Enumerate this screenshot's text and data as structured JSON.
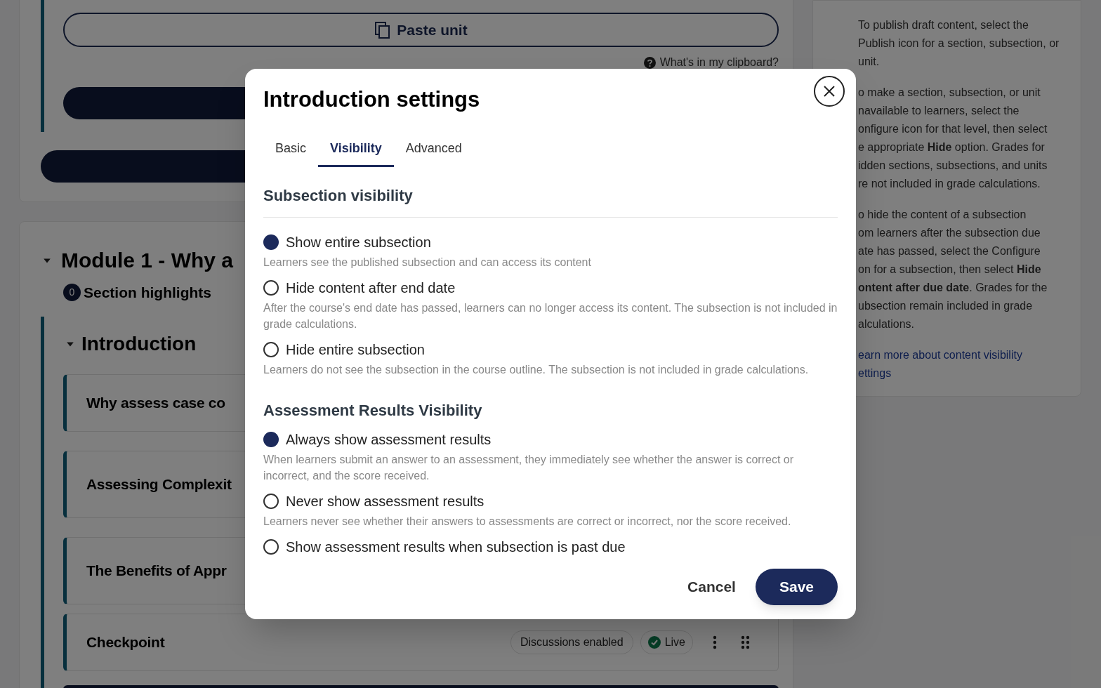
{
  "background": {
    "paste_button": "Paste unit",
    "clipboard_link": "What's in my clipboard?",
    "section": {
      "title": "Module 1 - Why a",
      "expanded": true,
      "highlights_count": "0",
      "highlights_label": "Section highlights"
    },
    "subsection": {
      "title": "Introduction",
      "expanded": true
    },
    "units": [
      {
        "title": "Why assess case co"
      },
      {
        "title": "Assessing Complexit"
      },
      {
        "title": "The Benefits of Appr"
      },
      {
        "title": "Checkpoint",
        "badges": [
          "Discussions enabled"
        ],
        "status": "Live"
      }
    ]
  },
  "help": {
    "paragraphs": [
      {
        "kind": "text",
        "lines": [
          "To publish draft content, select the",
          "Publish icon for a section, subsection, or",
          "unit."
        ]
      },
      {
        "kind": "text",
        "lines": [
          "o make a section, subsection, or unit",
          "navailable to learners, select the",
          "onfigure icon for that level, then select",
          "e appropriate **Hide** option. Grades for",
          "idden sections, subsections, and units",
          "re not included in grade calculations."
        ]
      },
      {
        "kind": "text",
        "lines": [
          "o hide the content of a subsection",
          "om learners after the subsection due",
          "ate has passed, select the Configure",
          "on for a subsection, then select **Hide**",
          "**ontent after due date**. Grades for the",
          "ubsection remain included in grade",
          "alculations."
        ]
      },
      {
        "kind": "link",
        "lines": [
          "earn more about content visibility",
          "ettings"
        ]
      }
    ]
  },
  "dialog": {
    "title": "Introduction settings",
    "tabs": [
      {
        "label": "Basic",
        "selected": false
      },
      {
        "label": "Visibility",
        "selected": true
      },
      {
        "label": "Advanced",
        "selected": false
      }
    ],
    "groups": [
      {
        "heading": "Subsection visibility",
        "divider": true,
        "options": [
          {
            "label": "Show entire subsection",
            "selected": true,
            "description": "Learners see the published subsection and can access its content"
          },
          {
            "label": "Hide content after end date",
            "selected": false,
            "description": "After the course's end date has passed, learners can no longer access its content. The subsection is not included in grade calculations."
          },
          {
            "label": "Hide entire subsection",
            "selected": false,
            "description": "Learners do not see the subsection in the course outline. The subsection is not included in grade calculations."
          }
        ]
      },
      {
        "heading": "Assessment Results Visibility",
        "divider": false,
        "options": [
          {
            "label": "Always show assessment results",
            "selected": true,
            "description": "When learners submit an answer to an assessment, they immediately see whether the answer is correct or incorrect, and the score received."
          },
          {
            "label": "Never show assessment results",
            "selected": false,
            "description": "Learners never see whether their answers to assessments are correct or incorrect, nor the score received."
          },
          {
            "label": "Show assessment results when subsection is past due",
            "selected": false
          }
        ]
      }
    ],
    "cancel": "Cancel",
    "save": "Save"
  }
}
